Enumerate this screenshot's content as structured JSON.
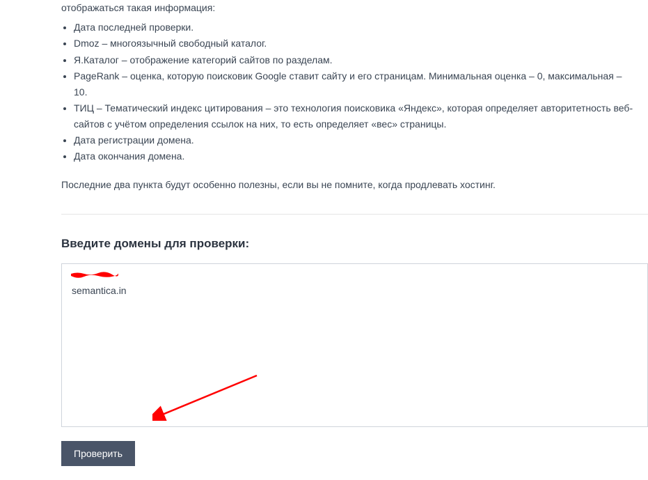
{
  "partial_text": "отображаться такая информация:",
  "bullets": [
    "Дата последней проверки.",
    "Dmoz – многоязычный свободный каталог.",
    "Я.Каталог – отображение категорий сайтов по разделам.",
    "PageRank – оценка, которую поисковик Google ставит сайту и его страницам. Минимальная оценка – 0, максимальная – 10.",
    "ТИЦ – Тематический индекс цитирования – это технология поисковика «Яндекс», которая определяет авторитетность веб-сайтов с учётом определения ссылок на них, то есть определяет «вес» страницы.",
    "Дата регистрации домена.",
    "Дата окончания домена."
  ],
  "note": "Последние два пункта будут особенно полезны, если вы не помните, когда продлевать хостинг.",
  "form": {
    "heading": "Введите домены для проверки:",
    "textarea_value": "semantica.in",
    "submit_label": "Проверить"
  }
}
